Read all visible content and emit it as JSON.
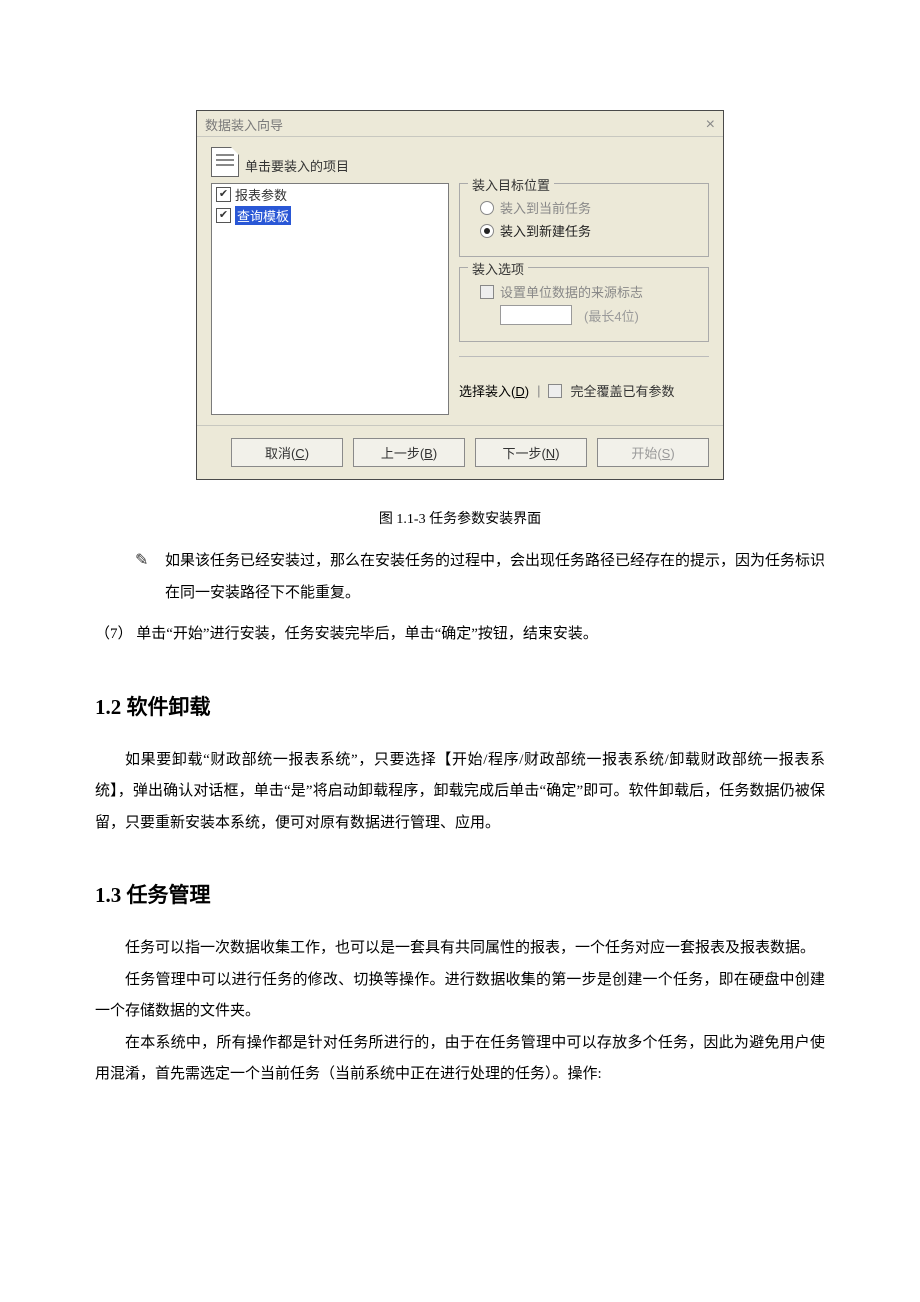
{
  "dialog": {
    "title": "数据装入向导",
    "header": "单击要装入的项目",
    "items": {
      "item1": "报表参数",
      "item2": "查询模板"
    },
    "target_group": {
      "legend": "装入目标位置",
      "opt1": "装入到当前任务",
      "opt2": "装入到新建任务"
    },
    "options_group": {
      "legend": "装入选项",
      "chk_label": "设置单位数据的来源标志",
      "hint": "(最长4位)"
    },
    "select_load": {
      "prefix": "选择装入(",
      "accel": "D",
      "suffix": ")"
    },
    "cover_chk": "完全覆盖已有参数",
    "buttons": {
      "cancel": {
        "prefix": "取消(",
        "accel": "C",
        "suffix": ")"
      },
      "back": {
        "prefix": "上一步(",
        "accel": "B",
        "suffix": ")"
      },
      "next": {
        "prefix": "下一步(",
        "accel": "N",
        "suffix": ")"
      },
      "start": {
        "prefix": "开始(",
        "accel": "S",
        "suffix": ")"
      }
    }
  },
  "doc": {
    "caption": "图 1.1-3 任务参数安装界面",
    "note1": "如果该任务已经安装过，那么在安装任务的过程中，会出现任务路径已经存在的提示，因为任务标识在同一安装路径下不能重复。",
    "step7": "（7）  单击“开始”进行安装，任务安装完毕后，单击“确定”按钮，结束安装。",
    "h12": "1.2 软件卸载",
    "p12": "如果要卸载“财政部统一报表系统”，只要选择【开始/程序/财政部统一报表系统/卸载财政部统一报表系统】，弹出确认对话框，单击“是”将启动卸载程序，卸载完成后单击“确定”即可。软件卸载后，任务数据仍被保留，只要重新安装本系统，便可对原有数据进行管理、应用。",
    "h13": "1.3 任务管理",
    "p13a": "任务可以指一次数据收集工作，也可以是一套具有共同属性的报表，一个任务对应一套报表及报表数据。",
    "p13b": "任务管理中可以进行任务的修改、切换等操作。进行数据收集的第一步是创建一个任务，即在硬盘中创建一个存储数据的文件夹。",
    "p13c": "在本系统中，所有操作都是针对任务所进行的，由于在任务管理中可以存放多个任务，因此为避免用户使用混淆，首先需选定一个当前任务（当前系统中正在进行处理的任务）。操作:"
  }
}
